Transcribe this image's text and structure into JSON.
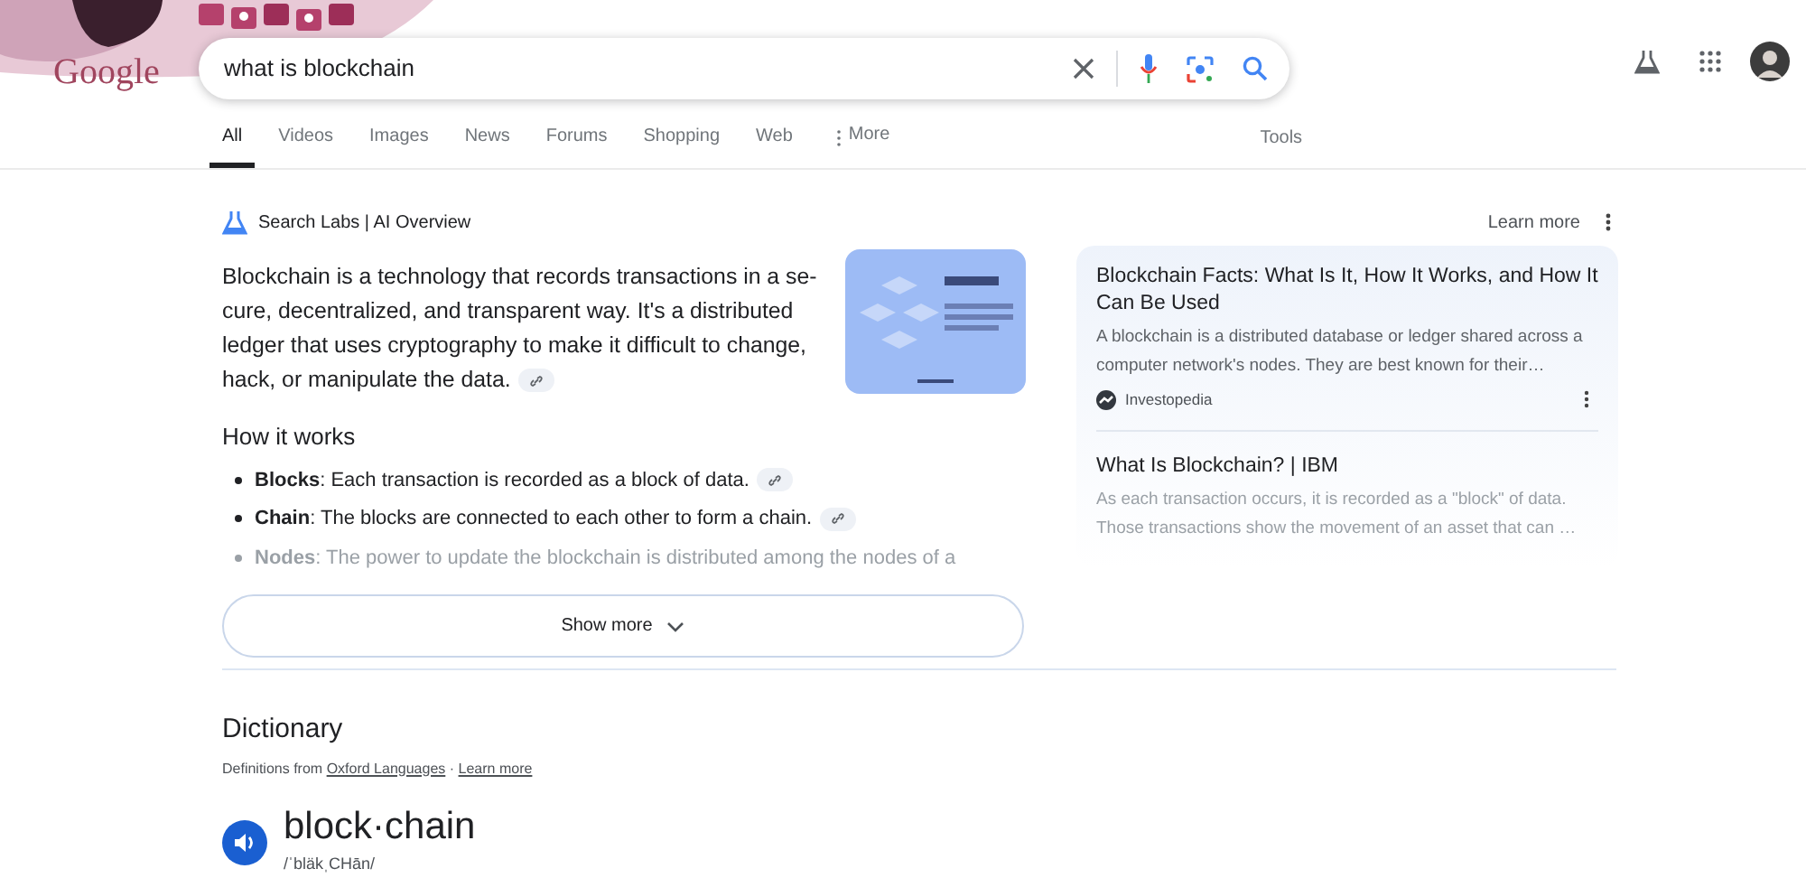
{
  "logo": "Google",
  "search": {
    "value": "what is blockchain"
  },
  "tabs": [
    {
      "label": "All",
      "selected": true
    },
    {
      "label": "Videos",
      "selected": false
    },
    {
      "label": "Images",
      "selected": false
    },
    {
      "label": "News",
      "selected": false
    },
    {
      "label": "Forums",
      "selected": false
    },
    {
      "label": "Shopping",
      "selected": false
    },
    {
      "label": "Web",
      "selected": false
    },
    {
      "label": "More",
      "selected": false,
      "kind": "more"
    }
  ],
  "tools": "Tools",
  "ai_overview": {
    "title": "Search Labs | AI Overview",
    "learn_more": "Learn more",
    "summary": "Blockchain is a technology that records transactions in a se-cure, decentralized, and transparent way. It's a distributed ledger that uses cryptography to make it difficult to change, hack, or manipulate the data.",
    "heading": "How it works",
    "bullets": [
      {
        "text": "**Blocks**: Each transaction is recorded as a block of data.",
        "faded": false
      },
      {
        "text": "**Chain**: The blocks are connected to each other to form a chain.",
        "faded": false
      },
      {
        "text": "**Nodes**: The power to update the blockchain is distributed among the nodes of a",
        "faded": true
      }
    ],
    "show_more": "Show more",
    "sources": [
      {
        "title": "Blockchain Facts: What Is It, How It Works, and How It Can Be Used",
        "snippet": "A blockchain is a distributed database or ledger shared across a computer network's nodes. They are best known for their…",
        "site": "Investopedia",
        "faded": false
      },
      {
        "title": "What Is Blockchain? | IBM",
        "snippet": "As each transaction occurs, it is recorded as a \"block\" of data. Those transactions show the movement of an asset that can …",
        "faded": true
      }
    ]
  },
  "dictionary": {
    "title": "Dictionary",
    "source_prefix": "Definitions from",
    "source": "Oxford Languages",
    "separator": "·",
    "learn_more": "Learn more",
    "word": "block·chain",
    "pronunciation": "/ˈbläkˌCHān/"
  }
}
